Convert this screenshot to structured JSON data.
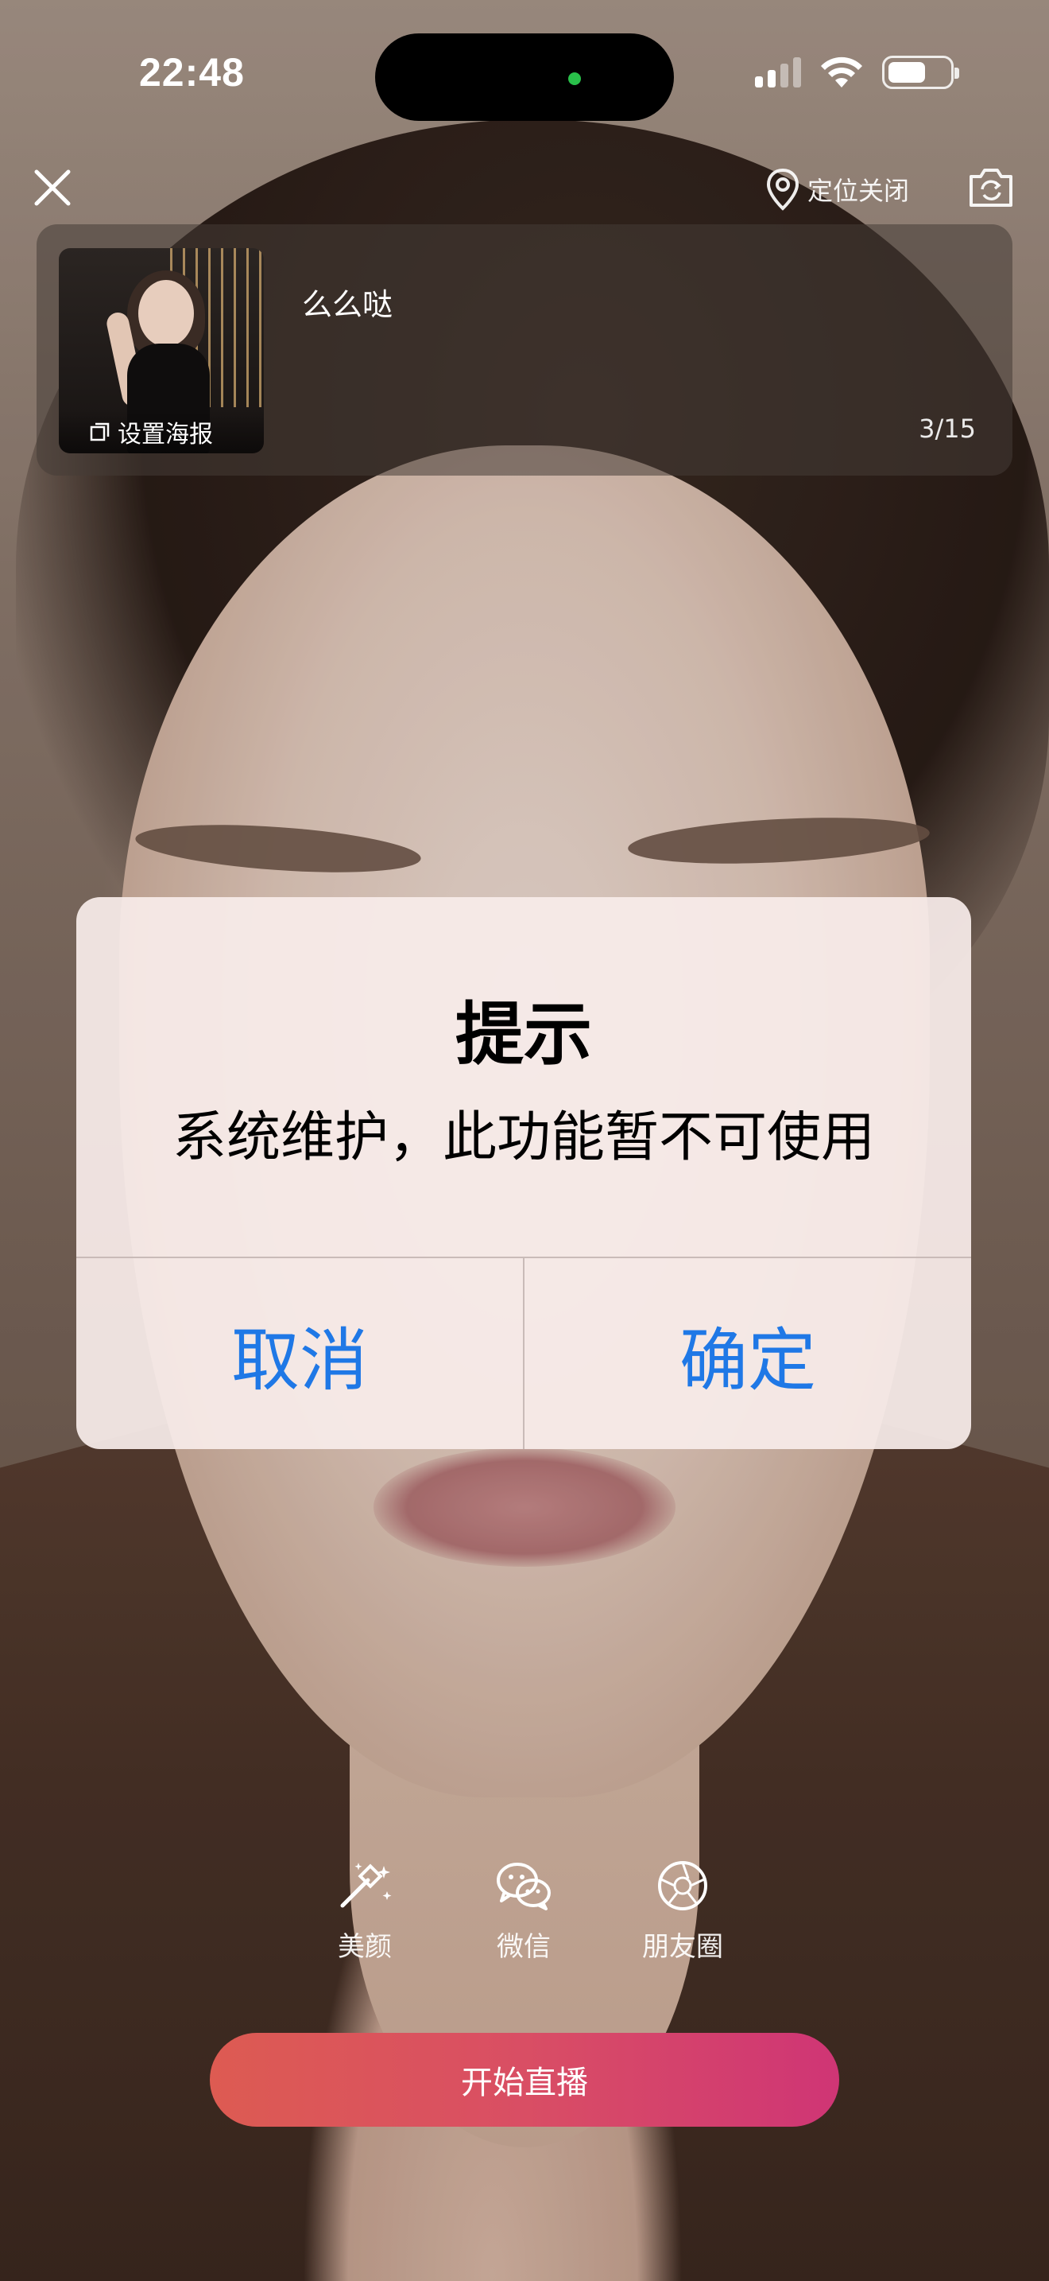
{
  "status_bar": {
    "time": "22:48"
  },
  "top_bar": {
    "close_icon": "close-icon",
    "location_icon": "location-pin-icon",
    "location_text": "定位关闭",
    "flip_camera_icon": "camera-flip-icon"
  },
  "info_card": {
    "poster_label": "设置海报",
    "title": "么么哒",
    "title_count": "3/15"
  },
  "alert": {
    "title": "提示",
    "message": "系统维护，此功能暂不可使用",
    "cancel_label": "取消",
    "confirm_label": "确定",
    "button_color": "#1f78e6"
  },
  "tools": [
    {
      "label": "美颜",
      "icon": "magic-wand-icon"
    },
    {
      "label": "微信",
      "icon": "wechat-icon"
    },
    {
      "label": "朋友圈",
      "icon": "moments-shutter-icon"
    }
  ],
  "start_button": {
    "label": "开始直播",
    "gradient_from": "#dd5b52",
    "gradient_to": "#cf3575"
  }
}
